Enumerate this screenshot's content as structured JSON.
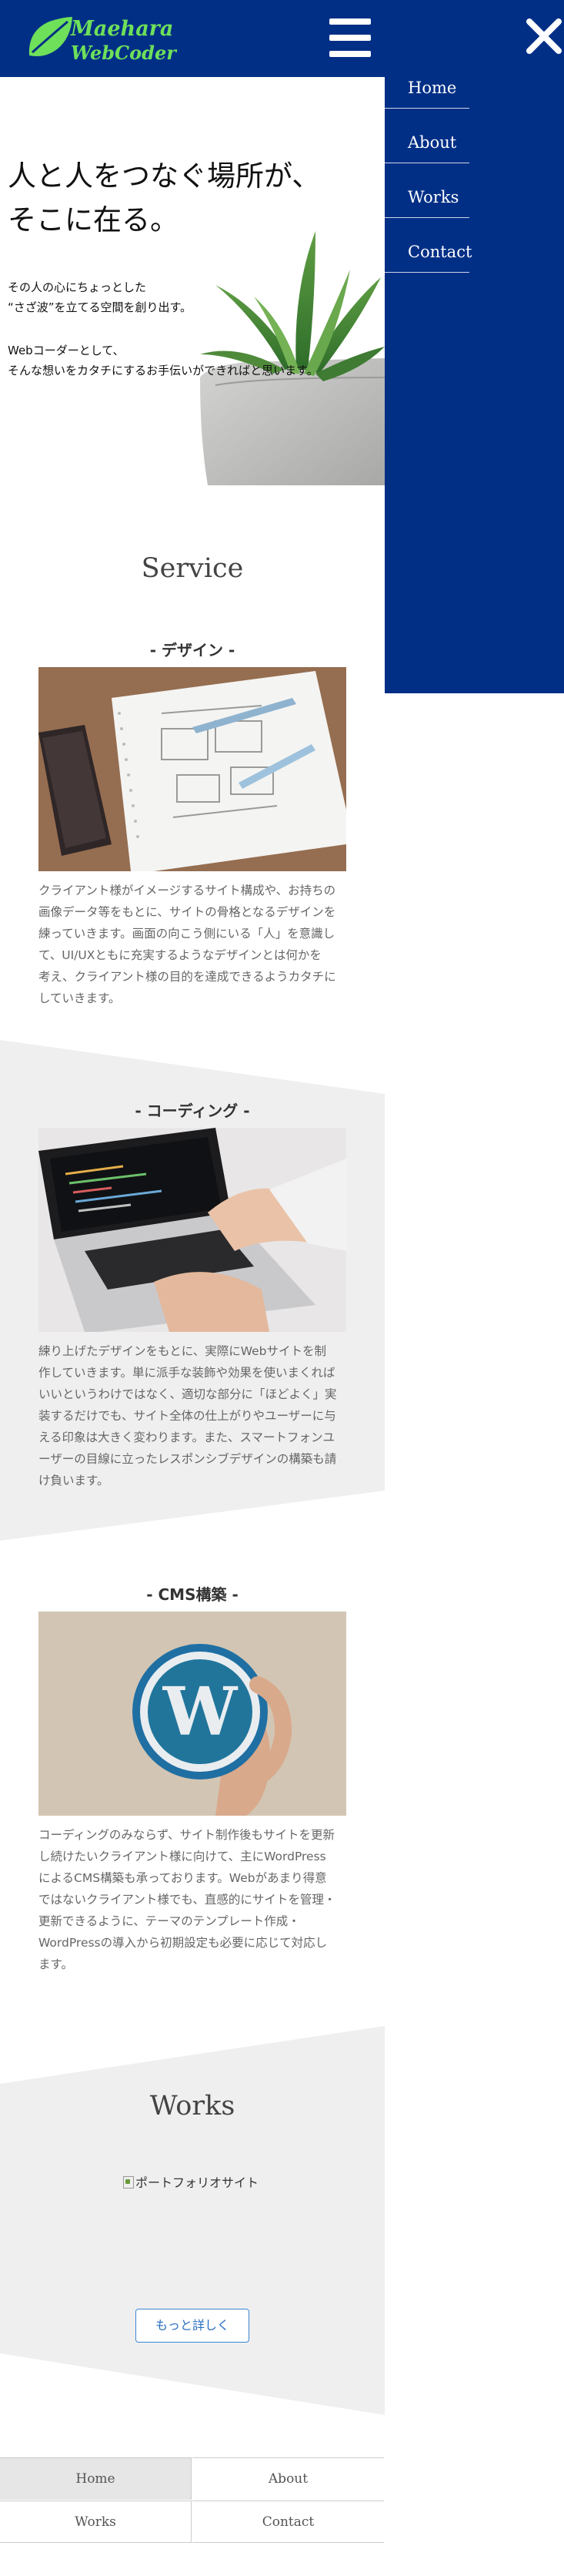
{
  "header": {
    "logo_line1": "Maehara",
    "logo_line2": "WebCoder"
  },
  "drawer": {
    "items": [
      {
        "label": "Home"
      },
      {
        "label": "About"
      },
      {
        "label": "Works"
      },
      {
        "label": "Contact"
      }
    ]
  },
  "hero": {
    "title_line1": "人と人をつなぐ場所が、",
    "title_line2": "そこに在る。",
    "text_line1": "その人の心にちょっとした",
    "text_line2": "“さざ波”を立てる空間を創り出す。",
    "text_line3": "Webコーダーとして、",
    "text_line4": "そんな想いをカタチにするお手伝いができればと思います。"
  },
  "service": {
    "title": "Service",
    "items": [
      {
        "title": "- デザイン -",
        "image": "design-sketch-photo",
        "lines": [
          "クライアント様がイメージするサイト構成や、お持ちの",
          "画像データ等をもとに、サイトの骨格となるデザインを",
          "練っていきます。画面の向こう側にいる「人」を意識し",
          "て、UI/UXともに充実するようなデザインとは何かを",
          "考え、クライアント様の目的を達成できるようカタチに",
          "していきます。"
        ]
      },
      {
        "title": "- コーディング -",
        "image": "laptop-coding-photo",
        "lines": [
          "練り上げたデザインをもとに、実際にWebサイトを制",
          "作していきます。単に派手な装飾や効果を使いまくれば",
          "いいというわけではなく、適切な部分に「ほどよく」実",
          "装するだけでも、サイト全体の仕上がりやユーザーに与",
          "える印象は大きく変わります。また、スマートフォンユ",
          "ーザーの目線に立ったレスポンシブデザインの構築も請",
          "け負います。"
        ]
      },
      {
        "title": "- CMS構築 -",
        "image": "wordpress-logo-photo",
        "lines": [
          "コーディングのみならず、サイト制作後もサイトを更新",
          "し続けたいクライアント様に向けて、主にWordPress",
          "によるCMS構築も承っております。Webがあまり得意",
          "ではないクライアント様でも、直感的にサイトを管理・",
          "更新できるように、テーマのテンプレート作成・",
          "WordPressの導入から初期設定も必要に応じて対応し",
          "ます。"
        ]
      }
    ]
  },
  "works": {
    "title": "Works",
    "portfolio_alt": "ポートフォリオサイト",
    "more_label": "もっと詳しく"
  },
  "footer_nav": [
    "Home",
    "About",
    "Works",
    "Contact"
  ],
  "colors": {
    "header_bg": "#012f86",
    "drawer_bg": "#012f86",
    "logo_green": "#6ee05a",
    "section_gray": "#efefef",
    "button_blue": "#3b86d6",
    "footer_active": "#e6e6e6"
  }
}
